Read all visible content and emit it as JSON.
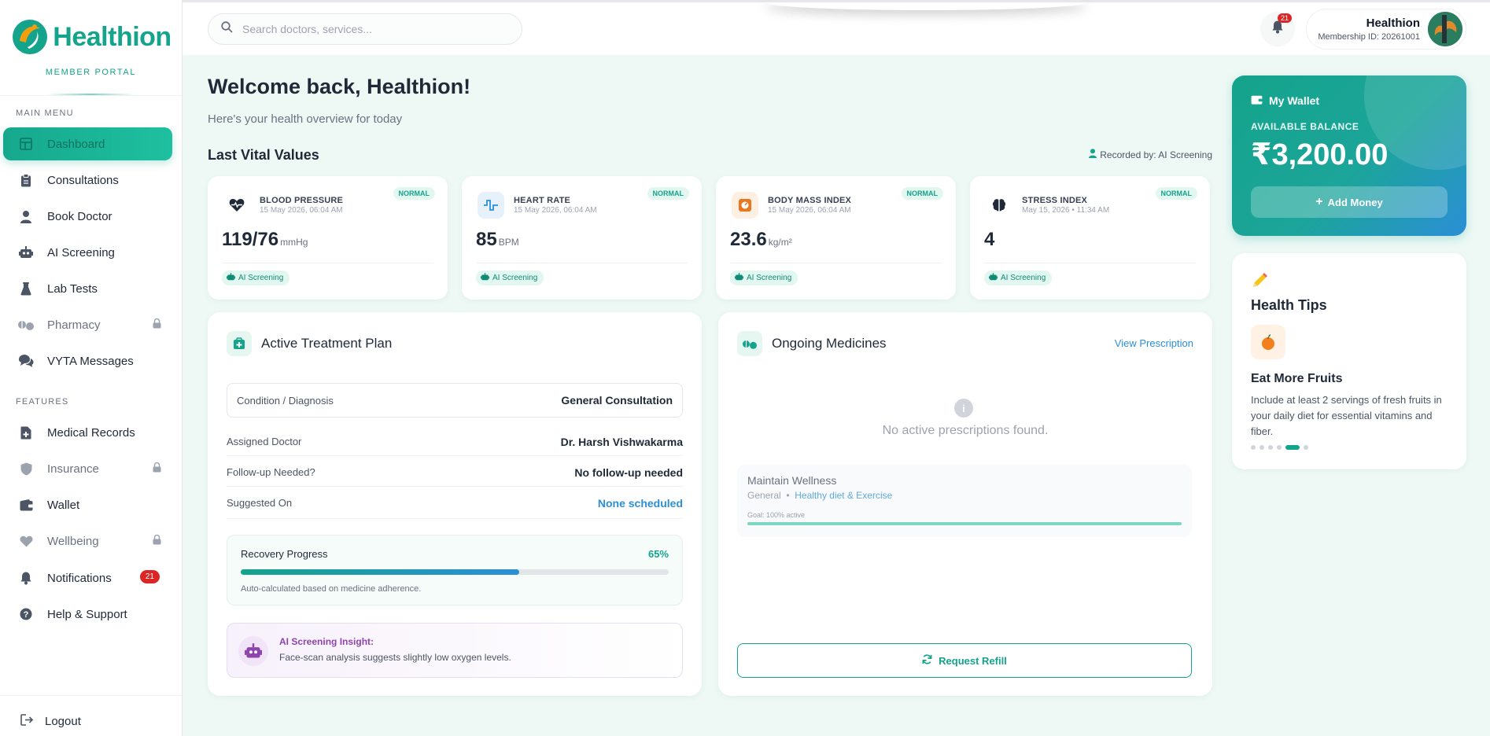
{
  "brand": {
    "name": "Healthion",
    "subtitle": "MEMBER PORTAL"
  },
  "sidebar": {
    "main_menu_label": "MAIN MENU",
    "features_label": "FEATURES",
    "items": [
      {
        "label": "Dashboard",
        "icon": "grid-icon",
        "active": true
      },
      {
        "label": "Consultations",
        "icon": "clipboard-icon"
      },
      {
        "label": "Book Doctor",
        "icon": "doctor-icon"
      },
      {
        "label": "AI Screening",
        "icon": "robot-icon"
      },
      {
        "label": "Lab Tests",
        "icon": "flask-icon"
      },
      {
        "label": "Pharmacy",
        "icon": "pills-icon",
        "locked": true
      },
      {
        "label": "VYTA Messages",
        "icon": "chat-icon"
      }
    ],
    "feature_items": [
      {
        "label": "Medical Records",
        "icon": "file-medical-icon"
      },
      {
        "label": "Insurance",
        "icon": "shield-icon",
        "locked": true
      },
      {
        "label": "Wallet",
        "icon": "wallet-icon"
      },
      {
        "label": "Wellbeing",
        "icon": "heart-icon",
        "locked": true
      },
      {
        "label": "Notifications",
        "icon": "bell-icon",
        "badge": "21"
      },
      {
        "label": "Help & Support",
        "icon": "question-icon"
      }
    ],
    "logout_label": "Logout"
  },
  "header": {
    "search_placeholder": "Search doctors, services...",
    "notification_count": "21",
    "profile_name": "Healthion",
    "membership_id": "Membership ID: 20261001"
  },
  "welcome": {
    "title": "Welcome back, Healthion!",
    "subtitle": "Here's your health overview for today"
  },
  "vitals": {
    "title": "Last Vital Values",
    "recorded_by": "Recorded by: AI Screening",
    "cards": [
      {
        "name": "BLOOD PRESSURE",
        "time": "15 May 2026, 06:04 AM",
        "status": "NORMAL",
        "value": "119/76",
        "unit": "mmHg",
        "tag": "AI Screening",
        "icon": "heart-pulse-icon"
      },
      {
        "name": "HEART RATE",
        "time": "15 May 2026, 06:04 AM",
        "status": "NORMAL",
        "value": "85",
        "unit": "BPM",
        "tag": "AI Screening",
        "icon": "pulse-wave-icon"
      },
      {
        "name": "BODY MASS INDEX",
        "time": "15 May 2026, 06:04 AM",
        "status": "NORMAL",
        "value": "23.6",
        "unit": "kg/m²",
        "tag": "AI Screening",
        "icon": "weight-scale-icon"
      },
      {
        "name": "STRESS INDEX",
        "time": "May 15, 2026 • 11:34 AM",
        "status": "NORMAL",
        "value": "4",
        "unit": "",
        "tag": "AI Screening",
        "icon": "brain-icon"
      }
    ]
  },
  "treatment": {
    "title": "Active Treatment Plan",
    "condition_label": "Condition / Diagnosis",
    "condition_value": "General Consultation",
    "doctor_label": "Assigned Doctor",
    "doctor_value": "Dr. Harsh Vishwakarma",
    "followup_label": "Follow-up Needed?",
    "followup_value": "No follow-up needed",
    "suggested_label": "Suggested On",
    "suggested_value": "None scheduled",
    "progress_label": "Recovery Progress",
    "progress_value": 65,
    "progress_text": "65%",
    "progress_note": "Auto-calculated based on medicine adherence.",
    "insight_title": "AI Screening Insight:",
    "insight_text": "Face-scan analysis suggests slightly low oxygen levels."
  },
  "medicines": {
    "title": "Ongoing Medicines",
    "view_link": "View Prescription",
    "empty_text": "No active prescriptions found.",
    "wellness_title": "Maintain Wellness",
    "wellness_type": "General",
    "wellness_plan": "Healthy diet & Exercise",
    "wellness_goal": "Goal: 100% active",
    "refill_label": "Request Refill"
  },
  "wallet": {
    "title": "My Wallet",
    "balance_label": "AVAILABLE BALANCE",
    "balance": "₹3,200.00",
    "add_money": "Add Money"
  },
  "tips": {
    "title": "Health Tips",
    "tip_title": "Eat More Fruits",
    "tip_body": "Include at least 2 servings of fresh fruits in your daily diet for essential vitamins and fiber.",
    "dot_count": 6,
    "active_dot": 4
  },
  "colors": {
    "brand": "#14a38b",
    "accent_blue": "#2b8fd6",
    "danger": "#dc2626",
    "insight_purple": "#8e44ad"
  }
}
